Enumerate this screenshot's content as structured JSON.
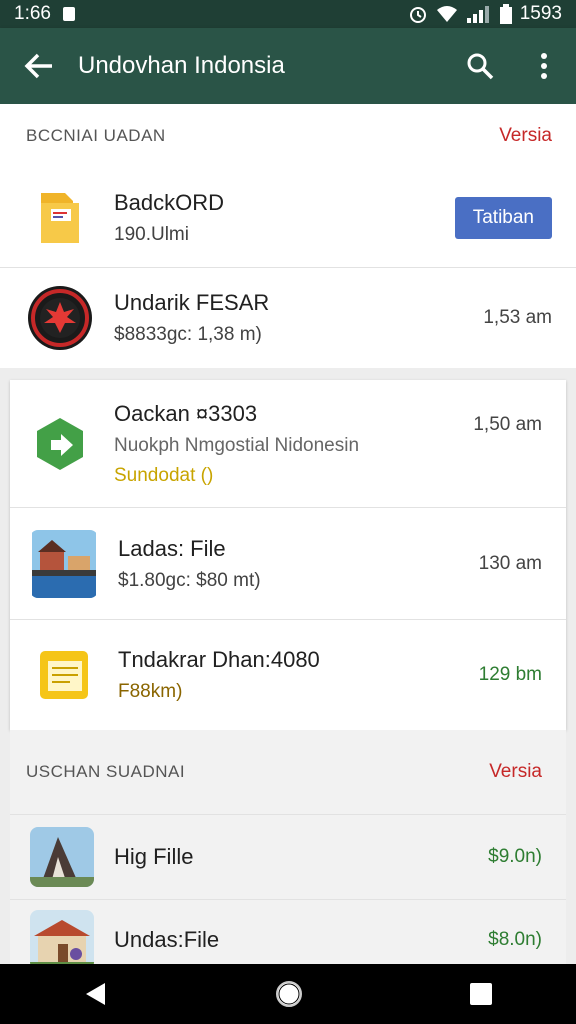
{
  "status": {
    "time": "1:66",
    "clock": "1593"
  },
  "appbar": {
    "title": "Undovhan Indonsia"
  },
  "section1": {
    "header": "BCCNIAI UADAN",
    "link": "Versia",
    "items": [
      {
        "title": "BadckORD",
        "subtitle": "190.Ulmi",
        "button": "Tatiban"
      },
      {
        "title": "Undarik FESAR",
        "subtitle": "$8833gc: 1,38 m)",
        "time": "1,53 am"
      }
    ]
  },
  "section2": {
    "items": [
      {
        "title": "Oackan ¤3303",
        "subtitle": "Nuokph Nmgostial Nidonesin",
        "extra": "Sundodat ()",
        "time": "1,50 am"
      },
      {
        "title": "Ladas: File",
        "subtitle": "$1.80gc: $80 mt)",
        "time": "130 am"
      },
      {
        "title": "Tndakrar Dhan:4080",
        "subtitle": "F88km)",
        "time": "129 bm"
      }
    ]
  },
  "section3": {
    "header": "USCHAN SUADNAI",
    "link": "Versia",
    "items": [
      {
        "title": "Hig Fille",
        "time": "$9.0n)"
      },
      {
        "title": "Undas:File",
        "time": "$8.0n)"
      }
    ]
  },
  "colors": {
    "appbar": "#2a5447",
    "accent_red": "#c62828",
    "button_blue": "#4a6fc4",
    "price_green": "#2e7d32"
  }
}
